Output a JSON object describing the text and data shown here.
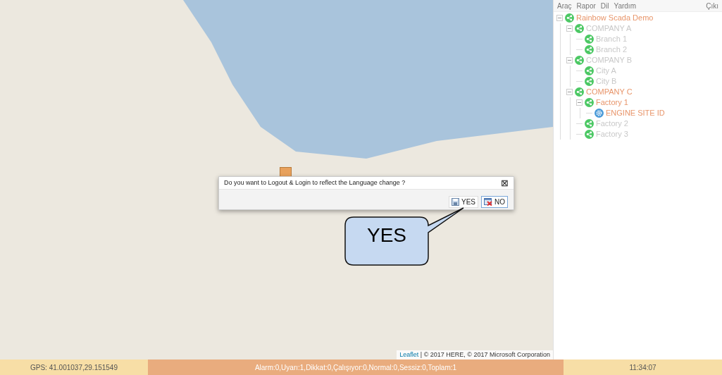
{
  "map": {
    "attribution": {
      "link": "Leaflet",
      "text": " | © 2017 HERE, © 2017 Microsoft Corporation"
    }
  },
  "dialog": {
    "message": "Do you want to Logout & Login to reflect the Language change ?",
    "close": "⊠",
    "buttons": [
      {
        "kind": "yes",
        "label": "YES"
      },
      {
        "kind": "no",
        "label": "NO"
      }
    ]
  },
  "callout": {
    "text": "YES"
  },
  "menu": {
    "items": [
      "Araç",
      "Rapor",
      "Dil",
      "Yardım"
    ],
    "exit": "Çıkı"
  },
  "tree": [
    {
      "label": "Rainbow Scada Demo",
      "kind": "group",
      "color": "#e8956a",
      "expanded": true,
      "children": [
        {
          "label": "COMPANY A",
          "kind": "group",
          "color": "#c8c8c8",
          "expanded": true,
          "children": [
            {
              "label": "Branch 1",
              "kind": "group",
              "color": "#c8c8c8"
            },
            {
              "label": "Branch 2",
              "kind": "group",
              "color": "#c8c8c8"
            }
          ]
        },
        {
          "label": "COMPANY B",
          "kind": "group",
          "color": "#c8c8c8",
          "expanded": true,
          "children": [
            {
              "label": "City A",
              "kind": "group",
              "color": "#c8c8c8"
            },
            {
              "label": "City B",
              "kind": "group",
              "color": "#c8c8c8"
            }
          ]
        },
        {
          "label": "COMPANY C",
          "kind": "group",
          "color": "#e8956a",
          "expanded": true,
          "children": [
            {
              "label": "Factory 1",
              "kind": "group",
              "color": "#e8956a",
              "expanded": true,
              "children": [
                {
                  "label": "ENGINE SITE ID",
                  "kind": "site",
                  "color": "#e8956a"
                }
              ]
            },
            {
              "label": "Factory 2",
              "kind": "group",
              "color": "#c8c8c8"
            },
            {
              "label": "Factory 3",
              "kind": "group",
              "color": "#c8c8c8"
            }
          ]
        }
      ]
    }
  ],
  "status_bar": {
    "gps": "GPS: 41.001037,29.151549",
    "alarms": "Alarm:0,Uyarı:1,Dikkat:0,Çalışıyor:0,Normal:0,Sessiz:0,Toplam:1",
    "time": "11:34:07"
  }
}
